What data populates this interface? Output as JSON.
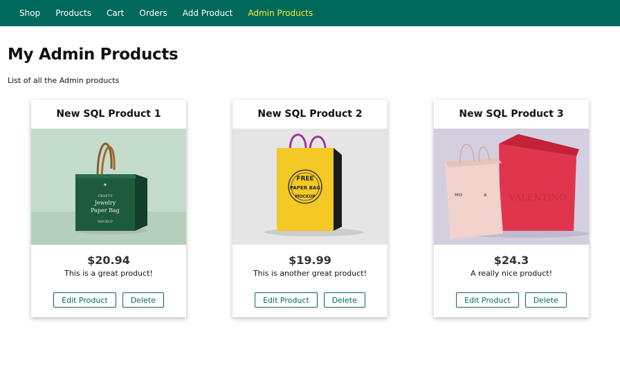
{
  "nav": {
    "items": [
      {
        "label": "Shop"
      },
      {
        "label": "Products"
      },
      {
        "label": "Cart"
      },
      {
        "label": "Orders"
      },
      {
        "label": "Add Product"
      },
      {
        "label": "Admin Products"
      }
    ],
    "active_index": 5
  },
  "page": {
    "title": "My Admin Products",
    "subtitle": "List of all the Admin products"
  },
  "products": [
    {
      "title": "New SQL Product 1",
      "price": "$20.94",
      "description": "This is a great product!",
      "edit_label": "Edit Product",
      "delete_label": "Delete",
      "image": {
        "bag_lines": [
          "CRAFTY",
          "Jewelry",
          "Paper Bag",
          "MOCKUP"
        ]
      }
    },
    {
      "title": "New SQL Product 2",
      "price": "$19.99",
      "description": "This is another great product!",
      "edit_label": "Edit Product",
      "delete_label": "Delete",
      "image": {
        "bag_lines": [
          "FREE",
          "PAPER BAG",
          "MOCKUP"
        ]
      }
    },
    {
      "title": "New SQL Product 3",
      "price": "$24.3",
      "description": "A really nice product!",
      "edit_label": "Edit Product",
      "delete_label": "Delete",
      "image": {
        "bag_lines": [
          "MO",
          "A",
          "VALENTINO"
        ]
      }
    }
  ],
  "colors": {
    "header_bg": "#00695c",
    "nav_active": "#ffeb3b",
    "button_accent": "#00695c"
  }
}
